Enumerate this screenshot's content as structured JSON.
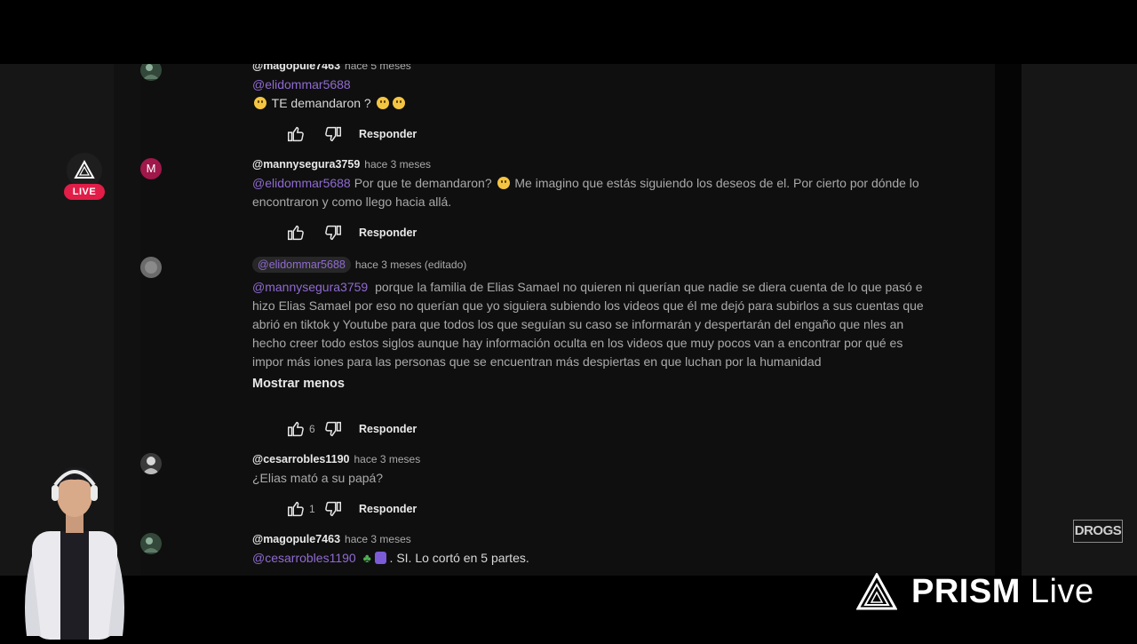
{
  "live_badge": {
    "label": "LIVE"
  },
  "brand": {
    "name": "PRISM",
    "suffix": "Live",
    "watermark": "DROGS"
  },
  "comments": [
    {
      "user": "@magopule7463",
      "time": "hace 5 meses",
      "mention": "@elidommar5688",
      "text": "TE demandaron ?",
      "likes": "",
      "reply": "Responder"
    },
    {
      "user": "@mannysegura3759",
      "time": "hace 3 meses",
      "avatar_letter": "M",
      "mention": "@elidommar5688",
      "text_a": "Por que te demandaron?",
      "text_b": "Me imagino que estás siguiendo los deseos de el. Por cierto por dónde lo encontraron y como llego hacia allá.",
      "likes": "",
      "reply": "Responder"
    },
    {
      "user": "@elidommar5688",
      "time": "hace 3 meses (editado)",
      "mention": "@mannysegura3759",
      "text": "porque la familia de Elias Samael no quieren ni querían que nadie se diera cuenta de lo que pasó e hizo Elias Samael por eso no querían que yo siguiera subiendo los videos que él me dejó para subirlos a sus cuentas que abrió en tiktok y Youtube para que todos los que seguían su caso se informarán y despertarán del engaño que nles an hecho creer todo estos siglos  aunque hay información oculta en los videos que muy pocos van a encontrar por qué es impor más iones para las personas que se encuentran más despiertas en que luchan por la humanidad",
      "show_less": "Mostrar menos",
      "likes": "6",
      "reply": "Responder"
    },
    {
      "user": "@cesarrobles1190",
      "time": "hace 3 meses",
      "text": "¿Elias mató a su papá?",
      "likes": "1",
      "reply": "Responder"
    },
    {
      "user": "@magopule7463",
      "time": "hace 3 meses",
      "mention": "@cesarrobles1190",
      "text": ". SI. Lo cortó en 5 partes."
    }
  ]
}
